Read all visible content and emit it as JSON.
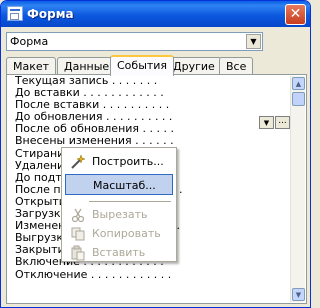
{
  "window": {
    "title": "Форма",
    "close_label": "✕"
  },
  "selector": {
    "value": "Форма",
    "arrow": "▼"
  },
  "tabs": [
    {
      "label": "Макет"
    },
    {
      "label": "Данные"
    },
    {
      "label": "События"
    },
    {
      "label": "Другие"
    },
    {
      "label": "Все"
    }
  ],
  "active_tab": "События",
  "properties": [
    "Текущая запись . . . . . . .",
    "До вставки . . . . . . . . . . . .",
    "После вставки . . . . . . . . . .",
    "До обновления . . . . . . . . . .",
    "После об обновления . . . . .",
    "Внесены изменения . . . . . .",
    "Стирание . . . . . . . . . . . . .",
    "Удаление . . . . . . . . . . . . .",
    "До подтверждения Del . . . .",
    "После подтверждения Del . .",
    "Открытие . . . . . . . . . . . . .",
    "Загрузка . . . . . . . . . . . . .",
    "Изменение размера . . . . . . .",
    "Выгрузка . . . . . . . . . . . . .",
    "Закрытие . . . . . . . . . . . . .",
    "Включение . . . . . . . . . . . .",
    "Отключение . . . . . . . . . . . ."
  ],
  "inline_controls": {
    "dropdown": "▼",
    "builder": "..."
  },
  "scrollbar": {
    "up": "▲",
    "down": "▼"
  },
  "context_menu": {
    "items": [
      {
        "label": "Построить...",
        "icon": "build-wand-icon",
        "enabled": true,
        "highlighted": false
      },
      {
        "label": "Масштаб...",
        "icon": "",
        "enabled": true,
        "highlighted": true
      },
      {
        "label": "Вырезать",
        "icon": "cut-icon",
        "enabled": false,
        "highlighted": false
      },
      {
        "label": "Копировать",
        "icon": "copy-icon",
        "enabled": false,
        "highlighted": false
      },
      {
        "label": "Вставить",
        "icon": "paste-icon",
        "enabled": false,
        "highlighted": false
      }
    ]
  }
}
